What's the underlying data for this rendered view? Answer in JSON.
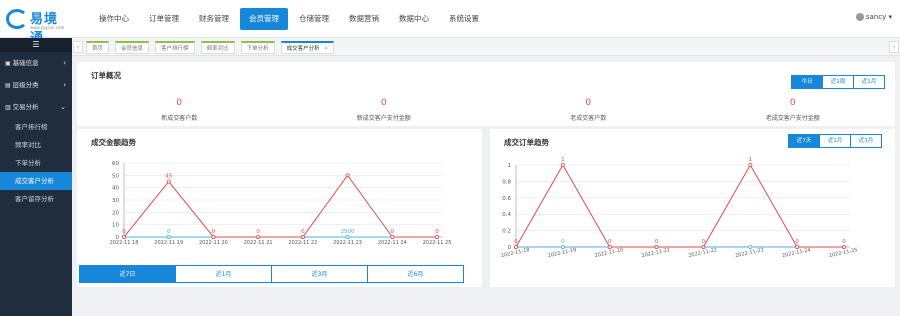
{
  "brand": {
    "name": "易境通",
    "url": "www.yoyran.com"
  },
  "nav": [
    {
      "label": "操作中心"
    },
    {
      "label": "订单管理"
    },
    {
      "label": "财务管理"
    },
    {
      "label": "会员管理",
      "active": true
    },
    {
      "label": "仓储管理"
    },
    {
      "label": "数据营销"
    },
    {
      "label": "数据中心"
    },
    {
      "label": "系统设置"
    }
  ],
  "user": {
    "name": "sancy"
  },
  "sidebar": {
    "toggle": "☰",
    "groups": [
      {
        "label": "基础信息",
        "arrow": "›"
      },
      {
        "label": "层级分类",
        "arrow": "›"
      },
      {
        "label": "交易分析",
        "arrow": "⌄"
      }
    ],
    "items": [
      {
        "label": "客户排行榜"
      },
      {
        "label": "频率对比"
      },
      {
        "label": "下单分析"
      },
      {
        "label": "成交客户分析",
        "active": true
      },
      {
        "label": "客户留存分析"
      }
    ]
  },
  "tabs": [
    {
      "label": "首页"
    },
    {
      "label": "会员信息"
    },
    {
      "label": "客户排行榜"
    },
    {
      "label": "频率对比"
    },
    {
      "label": "下单分析"
    },
    {
      "label": "成交客户分析",
      "active": true
    }
  ],
  "tab_nav": {
    "prev": "‹",
    "next": "›",
    "close": "✕"
  },
  "overview": {
    "title": "订单概况",
    "ranges": [
      "今日",
      "近1周",
      "近1月"
    ],
    "active_range": 0,
    "stats": [
      {
        "value": "0",
        "label": "新成交客户数"
      },
      {
        "value": "0",
        "label": "新成交客户支付金额"
      },
      {
        "value": "0",
        "label": "老成交客户数"
      },
      {
        "value": "0",
        "label": "老成交客户支付金额"
      }
    ]
  },
  "amount_card": {
    "title": "成交金额趋势",
    "ranges": [
      "近7日",
      "近1月",
      "近3月",
      "近6月"
    ],
    "active_range": 0
  },
  "orders_card": {
    "title": "成交订单趋势",
    "ranges": [
      "近7天",
      "近1月",
      "近3月"
    ],
    "active_range": 0
  },
  "colors": {
    "accent": "#1687d9",
    "red": "#e84a4a",
    "teal": "#47b4e0"
  },
  "chart_data": [
    {
      "type": "line",
      "title": "成交金额趋势",
      "x": [
        "2022-11-18",
        "2022-11-19",
        "2022-11-20",
        "2022-11-21",
        "2022-11-22",
        "2022-11-23",
        "2022-11-24",
        "2022-11-25"
      ],
      "yticks": [
        0,
        10,
        20,
        30,
        40,
        50,
        60
      ],
      "ylim": [
        0,
        60
      ],
      "series": [
        {
          "values": [
            0,
            45,
            0,
            0,
            0,
            50,
            0,
            0
          ],
          "labels": [
            "0",
            "45",
            "0",
            "0",
            "0",
            "",
            "0",
            "0"
          ],
          "color": "#e84a4a"
        },
        {
          "values": [
            0,
            0,
            0,
            0,
            0,
            0,
            0,
            0
          ],
          "labels": [
            "",
            "0",
            "",
            "",
            "",
            "2500",
            "",
            ""
          ],
          "color": "#47b4e0"
        }
      ]
    },
    {
      "type": "line",
      "title": "成交订单趋势",
      "x": [
        "2022-11-18",
        "2022-11-19",
        "2022-11-20",
        "2022-11-21",
        "2022-11-22",
        "2022-11-23",
        "2022-11-24",
        "2022-11-25"
      ],
      "yticks": [
        0,
        0.2,
        0.4,
        0.6,
        0.8,
        1
      ],
      "ylim": [
        0,
        1
      ],
      "series": [
        {
          "values": [
            0,
            1,
            0,
            0,
            0,
            1,
            0,
            0
          ],
          "labels": [
            "0",
            "1",
            "0",
            "0",
            "0",
            "1",
            "0",
            "0"
          ],
          "color": "#e84a4a"
        },
        {
          "values": [
            0,
            0,
            0,
            0,
            0,
            0,
            0,
            0
          ],
          "labels": [
            "",
            "0",
            "",
            "",
            "",
            "",
            "",
            ""
          ],
          "color": "#47b4e0"
        }
      ]
    }
  ]
}
